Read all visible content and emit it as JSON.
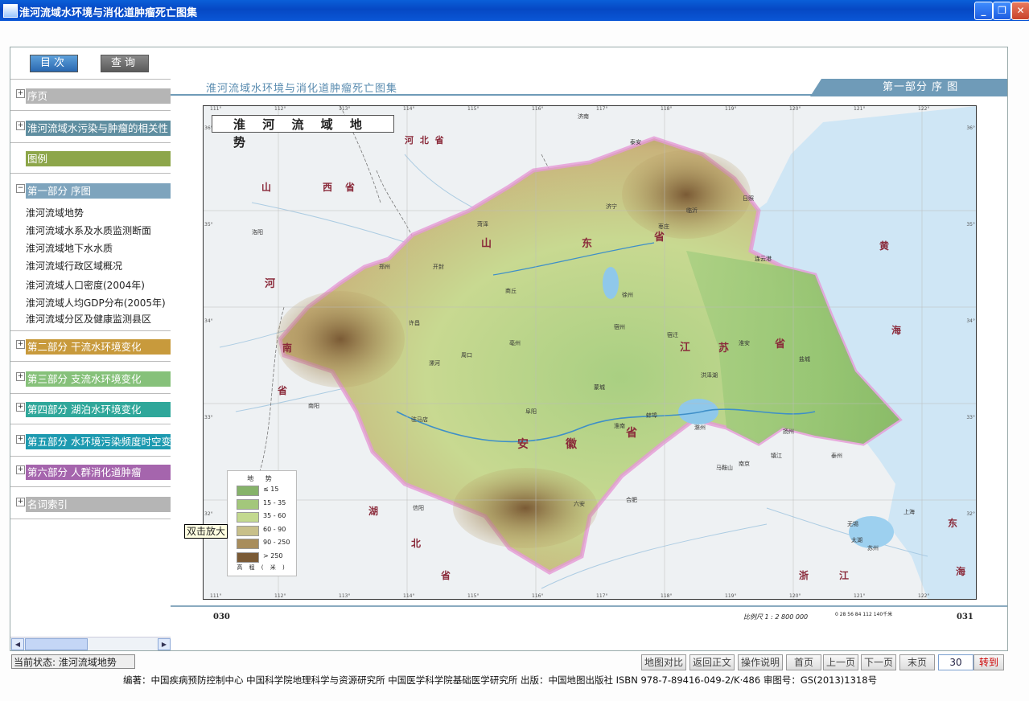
{
  "window": {
    "title": "淮河流域水环境与消化道肿瘤死亡图集",
    "minimize_glyph": "_",
    "maximize_glyph": "❐",
    "close_glyph": "✕"
  },
  "sidebar": {
    "btn_contents": "目次",
    "btn_query": "查询",
    "sections": [
      {
        "pm": "+",
        "label": "序页",
        "color": "#b5b5b5"
      },
      {
        "pm": "+",
        "label": "淮河流域水污染与肿瘤的相关性",
        "color": "#5f8ea0"
      },
      {
        "pm": "",
        "label": "图例",
        "color": "#8da64a"
      },
      {
        "pm": "−",
        "label": "第一部分  序图",
        "color": "#7ea4bd"
      },
      {
        "pm": "+",
        "label": "第二部分  干流水环境变化",
        "color": "#c89a3c"
      },
      {
        "pm": "+",
        "label": "第三部分  支流水环境变化",
        "color": "#86c17a"
      },
      {
        "pm": "+",
        "label": "第四部分  湖泊水环境变化",
        "color": "#2fa79a"
      },
      {
        "pm": "+",
        "label": "第五部分  水环境污染频度时空变化",
        "color": "#1d9ab0"
      },
      {
        "pm": "+",
        "label": "第六部分  人群消化道肿瘤",
        "color": "#a565ad"
      },
      {
        "pm": "+",
        "label": "名词索引",
        "color": "#b5b5b5"
      }
    ],
    "part1_items": [
      "淮河流域地势",
      "淮河流域水系及水质监测断面",
      "淮河流域地下水水质",
      "淮河流域行政区域概况",
      "淮河流域人口密度(2004年)",
      "淮河流域人均GDP分布(2005年)",
      "淮河流域分区及健康监测县区"
    ]
  },
  "page": {
    "header_title": "淮河流域水环境与消化道肿瘤死亡图集",
    "part_tab": "第一部分   序   图",
    "map_title": "淮 河 流 域 地 势",
    "page_left": "030",
    "page_right": "031",
    "scale_label": "比例尺   1 : 2 800 000",
    "scale_ticks": "0   28   56   84   112   140千米"
  },
  "map_labels": {
    "provinces": [
      "河 北 省",
      "山",
      "西",
      "省",
      "河",
      "南",
      "省",
      "山",
      "东",
      "省",
      "江",
      "苏",
      "省",
      "安",
      "徽",
      "省",
      "湖",
      "北",
      "省",
      "浙",
      "江",
      "黄",
      "海",
      "东",
      "海"
    ],
    "cities": [
      "济南",
      "郑州",
      "开封",
      "商丘",
      "周口",
      "许昌",
      "漯河",
      "驻马店",
      "阜阳",
      "淮南",
      "蚌埠",
      "徐州",
      "宿州",
      "连云港",
      "淮安",
      "盐城",
      "扬州",
      "南京",
      "合肥",
      "六安",
      "信阳",
      "南阳",
      "洛阳",
      "枣庄",
      "临沂",
      "日照",
      "济宁",
      "泰安",
      "菏泽",
      "宿迁",
      "亳州",
      "上海",
      "泰州",
      "无锡",
      "苏州",
      "马鞍山",
      "镇江",
      "滁州",
      "蒙城",
      "太湖",
      "洪泽湖"
    ],
    "lon_ticks": [
      "111°",
      "112°",
      "113°",
      "114°",
      "115°",
      "116°",
      "117°",
      "118°",
      "119°",
      "120°",
      "121°",
      "122°",
      "123°"
    ],
    "lat_ticks": [
      "36°",
      "35°",
      "34°",
      "33°",
      "32°",
      "31°"
    ]
  },
  "legend": {
    "title": "地 势",
    "unit": "高 程 ( 米 )",
    "classes": [
      {
        "label": "≤ 15",
        "color": "#86b36a"
      },
      {
        "label": "15 - 35",
        "color": "#a3c77b"
      },
      {
        "label": "35 - 60",
        "color": "#c3d98f"
      },
      {
        "label": "60 - 90",
        "color": "#c8c08a"
      },
      {
        "label": "90 - 250",
        "color": "#a88d5c"
      },
      {
        "label": "> 250",
        "color": "#7a5a35"
      }
    ]
  },
  "tooltip": "双击放大",
  "status": {
    "label": "当前状态: 淮河流域地势"
  },
  "nav": {
    "compare": "地图对比",
    "back": "返回正文",
    "help": "操作说明",
    "first": "首页",
    "prev": "上一页",
    "next": "下一页",
    "last": "末页",
    "page_value": "30",
    "goto": "转到"
  },
  "credits": "编著：中国疾病预防控制中心  中国科学院地理科学与资源研究所  中国医学科学院基础医学研究所    出版：中国地图出版社      ISBN 978-7-89416-049-2/K·486      审图号：GS(2013)1318号"
}
